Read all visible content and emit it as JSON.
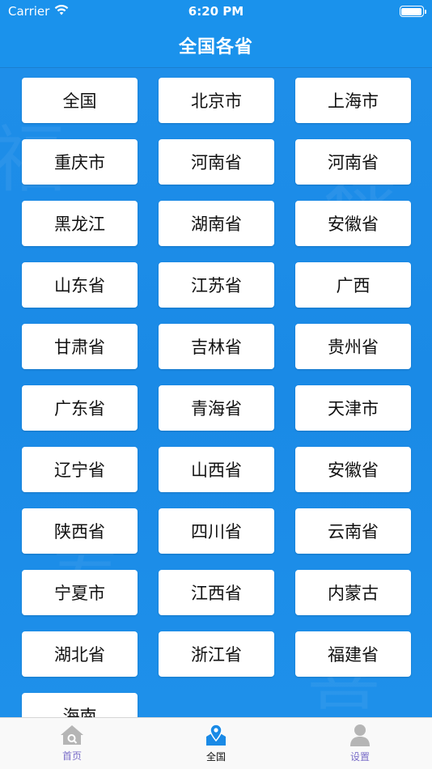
{
  "status_bar": {
    "carrier": "Carrier",
    "time": "6:20 PM"
  },
  "nav": {
    "title": "全国各省"
  },
  "provinces": [
    "全国",
    "北京市",
    "上海市",
    "重庆市",
    "河南省",
    "河南省",
    "黑龙江",
    "湖南省",
    "安徽省",
    "山东省",
    "江苏省",
    "广西",
    "甘肃省",
    "吉林省",
    "贵州省",
    "广东省",
    "青海省",
    "天津市",
    "辽宁省",
    "山西省",
    "安徽省",
    "陕西省",
    "四川省",
    "云南省",
    "宁夏市",
    "江西省",
    "内蒙古",
    "湖北省",
    "浙江省",
    "福建省",
    "海南"
  ],
  "tabs": [
    {
      "label": "首页",
      "icon": "home-icon",
      "active": false
    },
    {
      "label": "全国",
      "icon": "map-pin-icon",
      "active": true
    },
    {
      "label": "设置",
      "icon": "user-icon",
      "active": false
    }
  ],
  "colors": {
    "header": "#1a92ec",
    "background": "#1a8ae6",
    "tab_active_icon": "#1a8ae6",
    "tab_inactive_icon": "#b5b5b5",
    "tab_inactive_label": "#7b6fc9"
  }
}
